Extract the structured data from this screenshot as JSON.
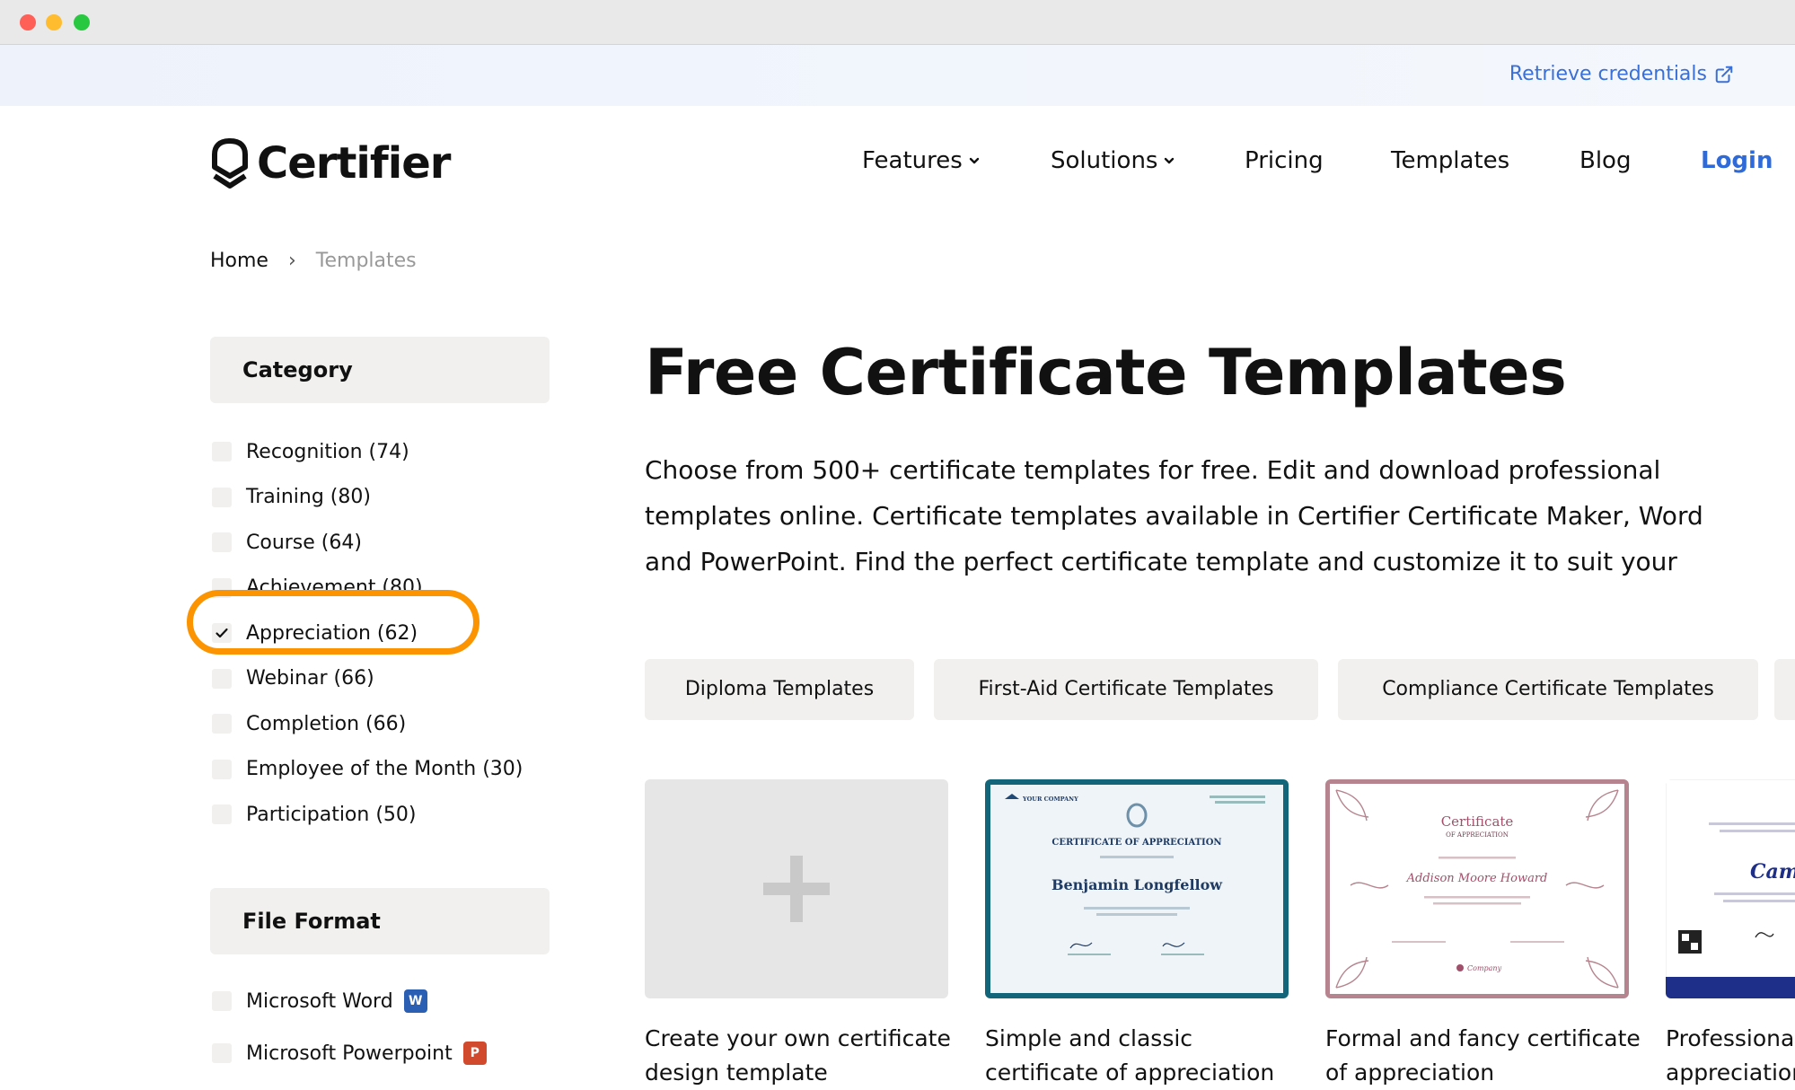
{
  "banner": {
    "retrieve_label": "Retrieve credentials"
  },
  "nav": {
    "logo_text": "Certifier",
    "features": "Features",
    "solutions": "Solutions",
    "pricing": "Pricing",
    "templates": "Templates",
    "blog": "Blog",
    "login": "Login"
  },
  "breadcrumb": {
    "home": "Home",
    "current": "Templates"
  },
  "sidebar": {
    "category_title": "Category",
    "categories": [
      {
        "label": "Recognition (74)",
        "checked": false
      },
      {
        "label": "Training (80)",
        "checked": false
      },
      {
        "label": "Course (64)",
        "checked": false
      },
      {
        "label": "Achievement (80)",
        "checked": false
      },
      {
        "label": "Appreciation (62)",
        "checked": true
      },
      {
        "label": "Webinar (66)",
        "checked": false
      },
      {
        "label": "Completion (66)",
        "checked": false
      },
      {
        "label": "Employee of the Month (30)",
        "checked": false
      },
      {
        "label": "Participation (50)",
        "checked": false
      }
    ],
    "format_title": "File Format",
    "formats": [
      {
        "label": "Microsoft Word",
        "icon": "word-icon"
      },
      {
        "label": "Microsoft Powerpoint",
        "icon": "powerpoint-icon"
      }
    ]
  },
  "main": {
    "title": "Free Certificate Templates",
    "intro_lines": [
      "Choose from 500+ certificate templates for free. Edit and download professional",
      "templates online. Certificate templates available in Certifier Certificate Maker, Word",
      "and PowerPoint. Find the perfect certificate template and customize it to suit your"
    ],
    "chips": [
      "Diploma Templates",
      "First-Aid Certificate Templates",
      "Compliance Certificate Templates",
      ""
    ],
    "cards": [
      {
        "title": "Create your own certificate design template"
      },
      {
        "title": "Simple and classic certificate of appreciation"
      },
      {
        "title": "Formal and fancy certificate of appreciation"
      },
      {
        "title": "Professional certificate of appreciation"
      }
    ]
  },
  "certs": {
    "c1": {
      "company": "YOUR COMPANY",
      "heading": "CERTIFICATE OF APPRECIATION",
      "name": "Benjamin Longfellow"
    },
    "c2": {
      "heading": "Certificate",
      "sub": "OF APPRECIATION",
      "name": "Addison Moore Howard",
      "brand": "Company"
    },
    "c4": {
      "name": "Camp"
    }
  },
  "colors": {
    "accent": "#2e6bd8",
    "highlight": "#fb9400",
    "chip_bg": "#f1f0ee"
  }
}
